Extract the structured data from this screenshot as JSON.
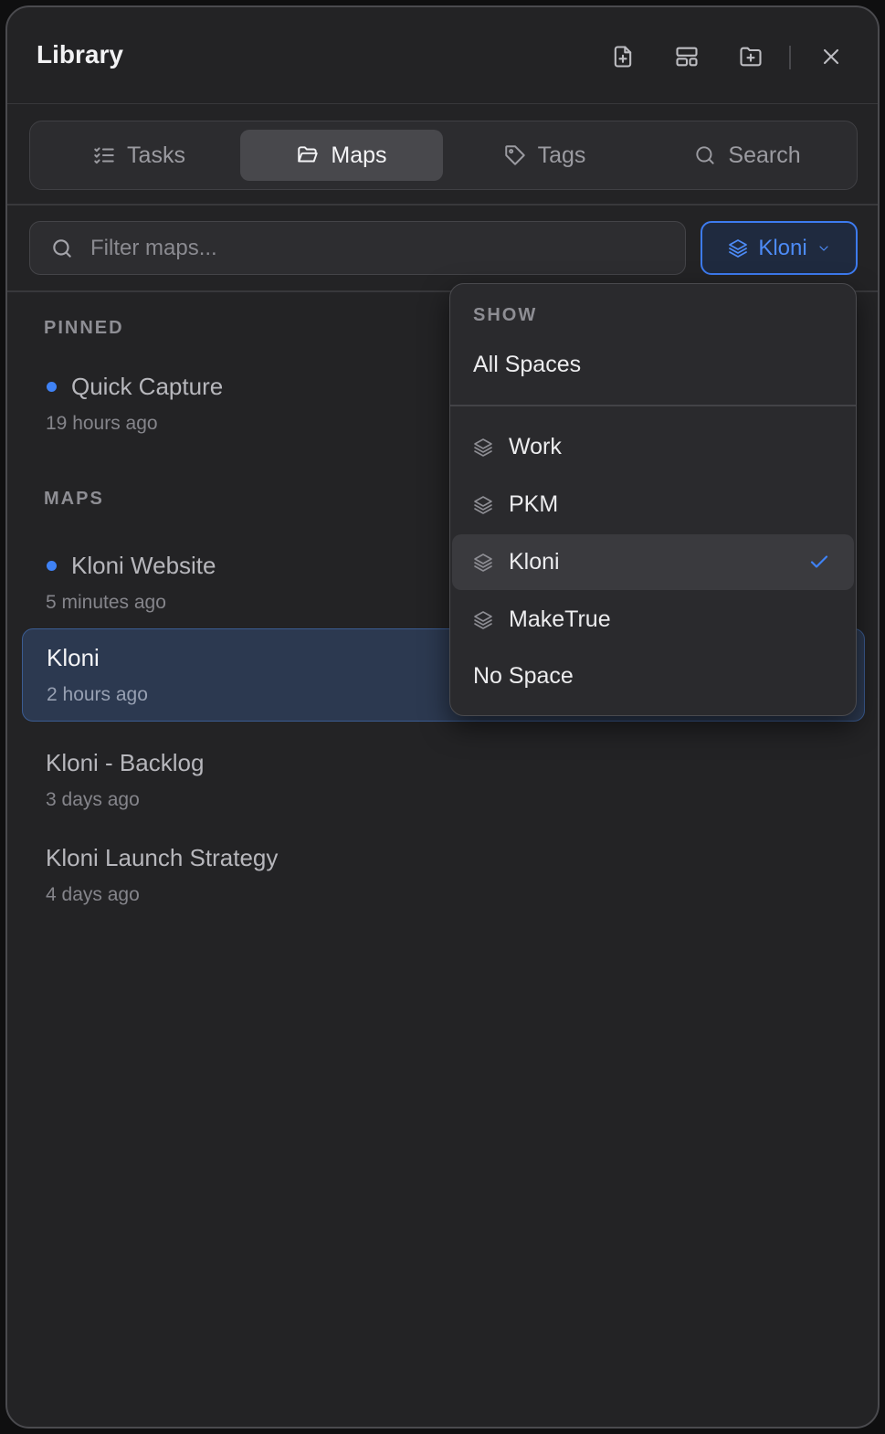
{
  "header": {
    "title": "Library",
    "icons": [
      "new-document-icon",
      "layout-icon",
      "new-folder-icon",
      "close-icon"
    ]
  },
  "tabs": [
    {
      "label": "Tasks",
      "icon": "checklist-icon",
      "active": false
    },
    {
      "label": "Maps",
      "icon": "folder-open-icon",
      "active": true
    },
    {
      "label": "Tags",
      "icon": "tag-icon",
      "active": false
    },
    {
      "label": "Search",
      "icon": "search-icon",
      "active": false
    }
  ],
  "filter": {
    "placeholder": "Filter maps...",
    "value": ""
  },
  "space_selector": {
    "label": "Kloni",
    "icon": "layers-icon",
    "accent": "#3f82f5"
  },
  "pinned": {
    "heading": "PINNED",
    "items": [
      {
        "name": "Quick Capture",
        "time": "19 hours ago",
        "dot": true
      }
    ]
  },
  "maps": {
    "heading": "MAPS",
    "items": [
      {
        "name": "Kloni Website",
        "time": "5 minutes ago",
        "dot": true
      },
      {
        "name": "Kloni",
        "time": "2 hours ago",
        "selected": true
      },
      {
        "name": "Kloni - Backlog",
        "time": "3 days ago"
      },
      {
        "name": "Kloni Launch Strategy",
        "time": "4 days ago"
      }
    ]
  },
  "dropdown": {
    "heading": "SHOW",
    "all": "All Spaces",
    "spaces": [
      {
        "label": "Work",
        "icon": "layers-icon"
      },
      {
        "label": "PKM",
        "icon": "layers-icon"
      },
      {
        "label": "Kloni",
        "icon": "layers-icon",
        "checked": true
      },
      {
        "label": "MakeTrue",
        "icon": "layers-icon"
      }
    ],
    "none": "No Space"
  }
}
